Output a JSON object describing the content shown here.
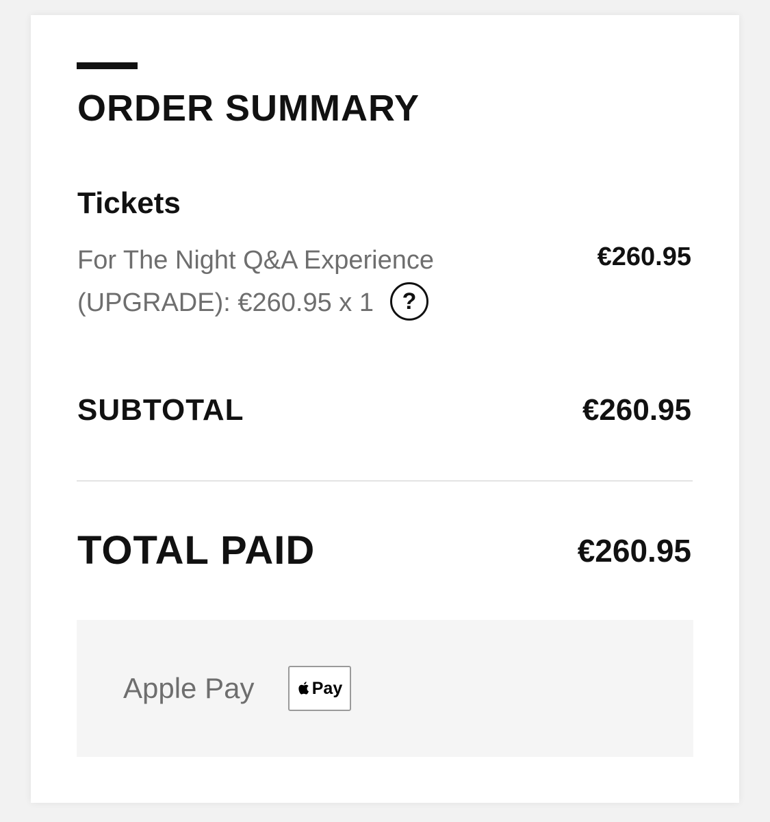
{
  "order_summary": {
    "title": "ORDER SUMMARY",
    "section_heading": "Tickets",
    "items": [
      {
        "description": "For The Night Q&A Experience (UPGRADE): €260.95 x 1",
        "price": "€260.95",
        "help_icon": "question-circle-icon",
        "help_symbol": "?"
      }
    ],
    "subtotal": {
      "label": "SUBTOTAL",
      "value": "€260.95"
    },
    "total": {
      "label": "TOTAL PAID",
      "value": "€260.95"
    },
    "payment": {
      "label": "Apple Pay",
      "badge_icon": "apple-logo-icon",
      "badge_text": "Pay"
    }
  },
  "colors": {
    "page_background": "#f2f2f2",
    "card_background": "#ffffff",
    "text_primary": "#111111",
    "text_secondary": "#6e6e6e",
    "divider": "#e3e3e3",
    "payment_box_background": "#f5f5f5"
  }
}
